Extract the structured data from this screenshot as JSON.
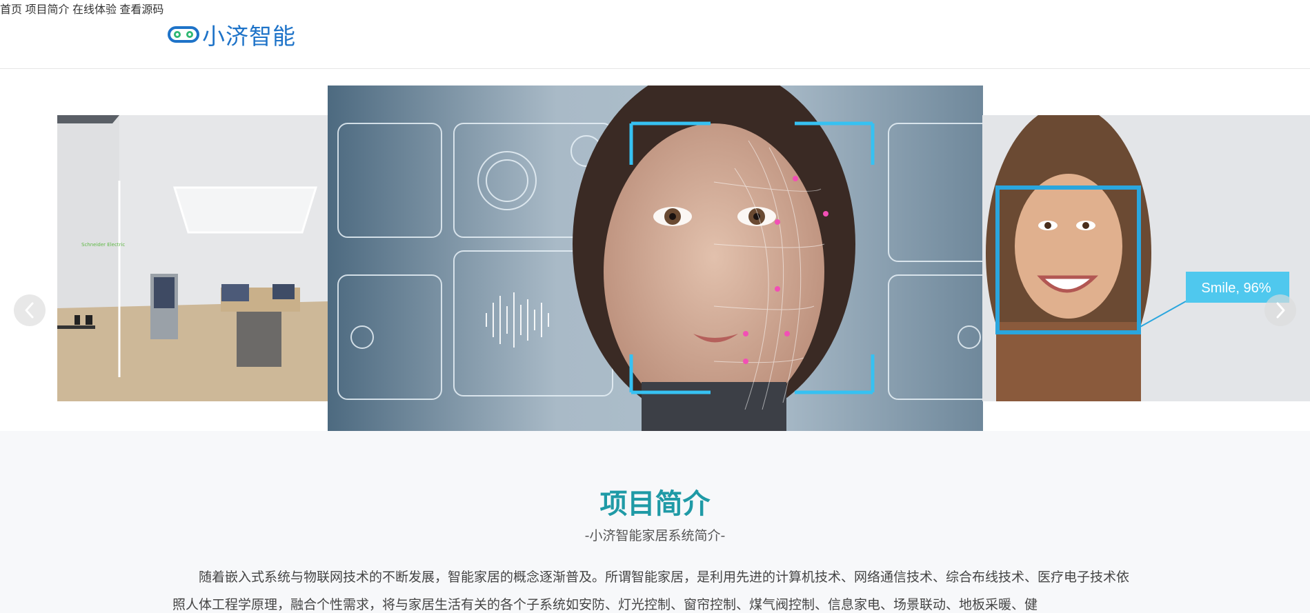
{
  "header": {
    "logo_text": "小济智能",
    "brand_color": "#1e73c8",
    "nav": [
      {
        "label": "首页"
      },
      {
        "label": "项目简介"
      },
      {
        "label": "在线体验"
      },
      {
        "label": "查看源码"
      }
    ]
  },
  "carousel": {
    "slides": [
      {
        "name": "smart-home-showroom"
      },
      {
        "name": "face-recognition-scan"
      },
      {
        "name": "smile-detection",
        "overlay_text": "Smile, 96%"
      }
    ],
    "prev_icon": "chevron-left-icon",
    "next_icon": "chevron-right-icon"
  },
  "intro": {
    "title": "项目简介",
    "title_color": "#1f9aa6",
    "subtitle": "-小济智能家居系统简介-",
    "text": "随着嵌入式系统与物联网技术的不断发展，智能家居的概念逐渐普及。所谓智能家居，是利用先进的计算机技术、网络通信技术、综合布线技术、医疗电子技术依照人体工程学原理，融合个性需求，将与家居生活有关的各个子系统如安防、灯光控制、窗帘控制、煤气阀控制、信息家电、场景联动、地板采暖、健"
  }
}
